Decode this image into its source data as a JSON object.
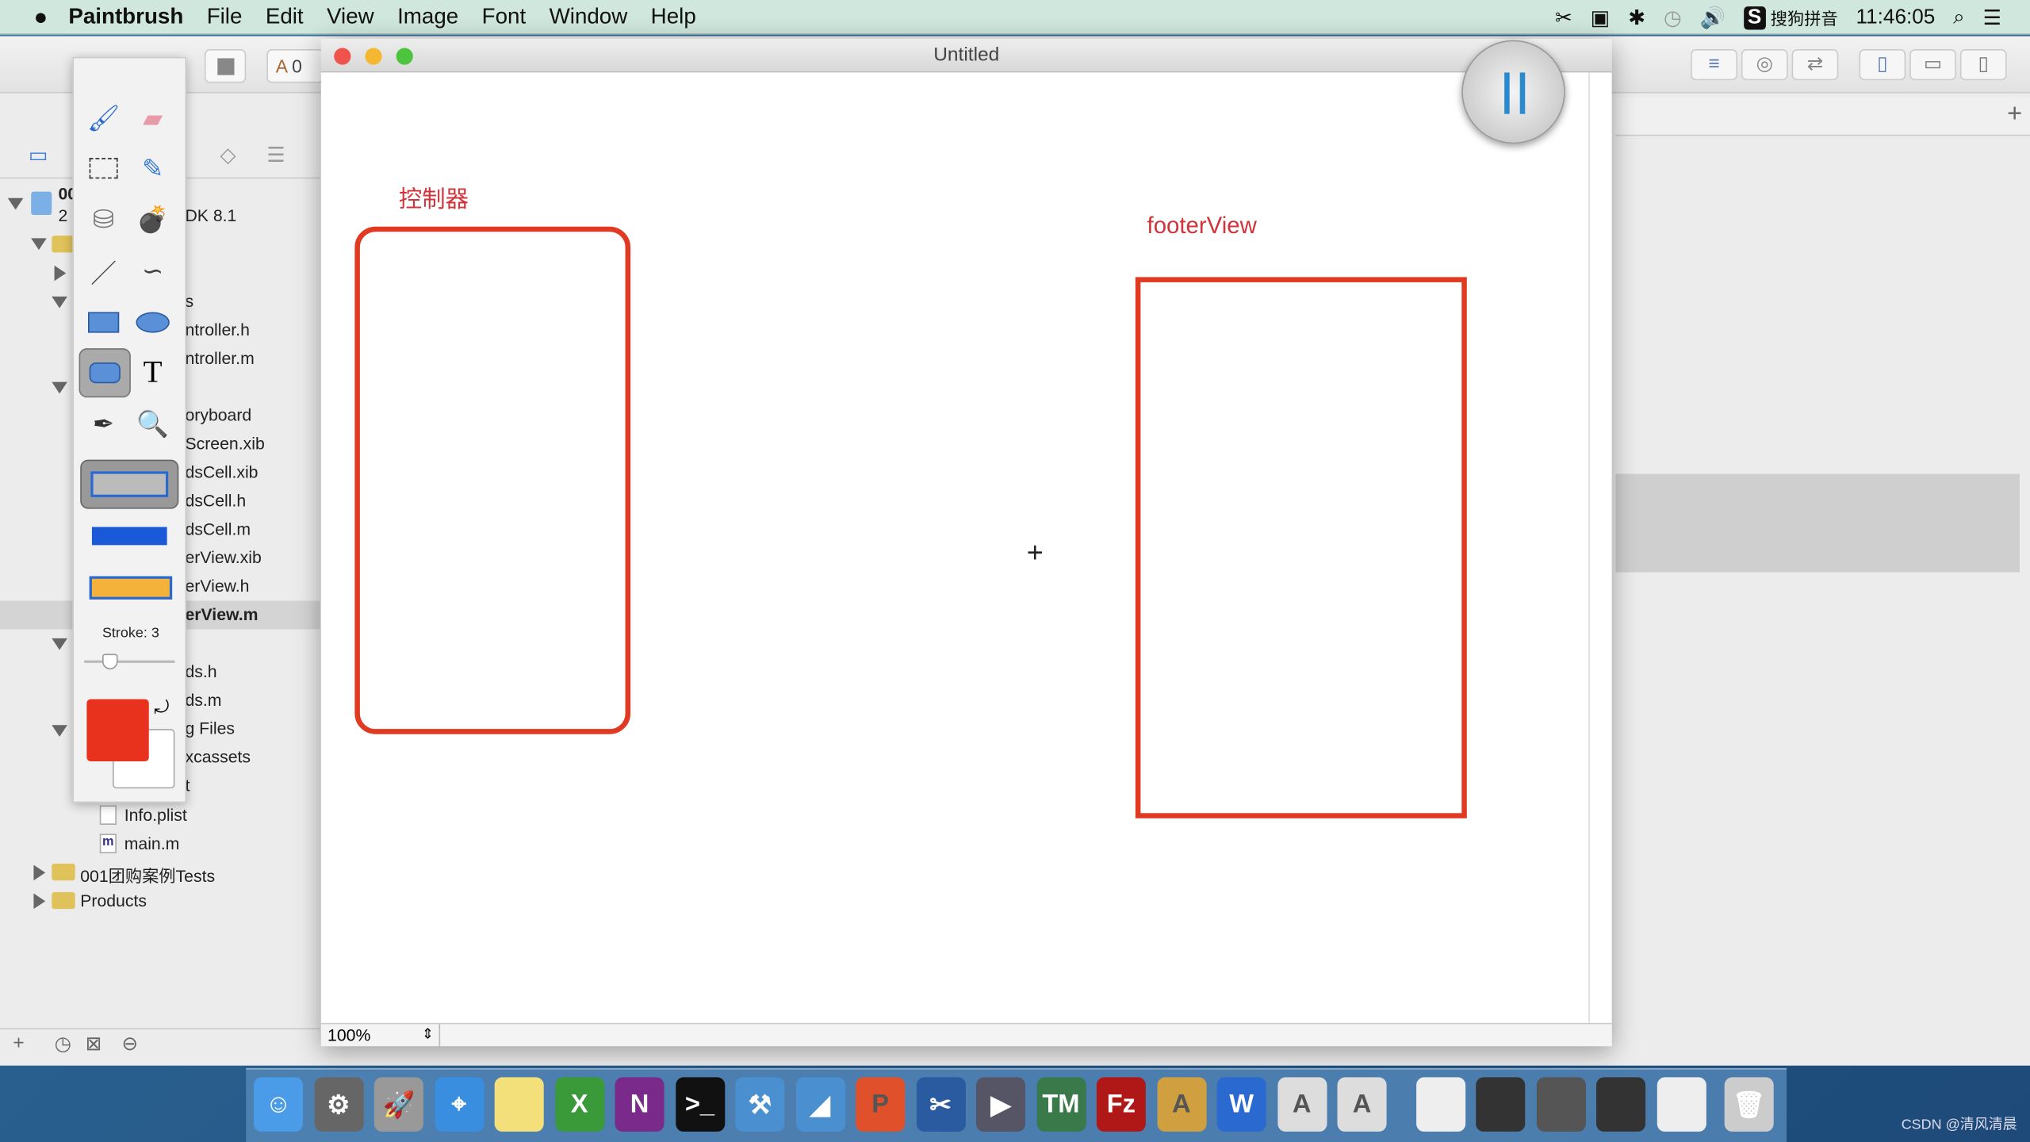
{
  "menubar": {
    "app": "Paintbrush",
    "items": [
      "File",
      "Edit",
      "View",
      "Image",
      "Font",
      "Window",
      "Help"
    ],
    "status": {
      "input_method": "搜狗拼音",
      "time": "11:46:05"
    }
  },
  "xcode": {
    "navigator": {
      "project": "00",
      "project_sub": "2",
      "sdk": "DK 8.1",
      "items": [
        "s",
        "ntroller.h",
        "ntroller.m",
        "oryboard",
        "Screen.xib",
        "dsCell.xib",
        "dsCell.h",
        "dsCell.m",
        "erView.xib",
        "erView.h",
        "erView.m",
        "ds.h",
        "ds.m",
        "g Files",
        "xcassets",
        "t"
      ],
      "info_plist": "Info.plist",
      "main_m": "main.m",
      "tests_group": "001团购案例Tests",
      "products_group": "Products"
    },
    "toolbar_partial": "0"
  },
  "paintbrush": {
    "title": "Untitled",
    "zoom": "100%",
    "stroke_label": "Stroke: 3",
    "stroke": 3,
    "fill_color": "#e8321e",
    "stroke_color": "#ffffff",
    "selected_tool": "rounded-rectangle",
    "canvas": {
      "label_left": "控制器",
      "label_right": "footerView",
      "shape_color": "#e03a22"
    }
  },
  "dock": {
    "apps": [
      {
        "name": "finder",
        "color": "#4a9be8",
        "glyph": "☺"
      },
      {
        "name": "system-preferences",
        "color": "#666",
        "glyph": "⚙"
      },
      {
        "name": "launchpad",
        "color": "#999",
        "glyph": "🚀"
      },
      {
        "name": "safari",
        "color": "#3a8ee0",
        "glyph": "⌖"
      },
      {
        "name": "notes",
        "color": "#f3e07a",
        "glyph": ""
      },
      {
        "name": "excel",
        "color": "#3a9a3a",
        "glyph": "X"
      },
      {
        "name": "onenote",
        "color": "#7a2a8a",
        "glyph": "N"
      },
      {
        "name": "terminal",
        "color": "#111",
        "glyph": ">_"
      },
      {
        "name": "xcode",
        "color": "#4a90d0",
        "glyph": "⚒"
      },
      {
        "name": "preview",
        "color": "#4a90d0",
        "glyph": "◢"
      },
      {
        "name": "powerpoint",
        "color": "#e0502a",
        "glyph": "P"
      },
      {
        "name": "screenshot",
        "color": "#2a5aa0",
        "glyph": "✂"
      },
      {
        "name": "video-app",
        "color": "#556",
        "glyph": "▶"
      },
      {
        "name": "tm-app",
        "color": "#3a7a4a",
        "glyph": "TM"
      },
      {
        "name": "filezilla",
        "color": "#b01818",
        "glyph": "Fz"
      },
      {
        "name": "app-store",
        "color": "#d0a040",
        "glyph": "A"
      },
      {
        "name": "word",
        "color": "#2a6ad0",
        "glyph": "W"
      },
      {
        "name": "textedit-1",
        "color": "#ddd",
        "glyph": "A"
      },
      {
        "name": "textedit-2",
        "color": "#ddd",
        "glyph": "A"
      },
      {
        "name": "minimized-window-1",
        "color": "#eee",
        "glyph": ""
      },
      {
        "name": "minimized-window-2",
        "color": "#333",
        "glyph": ""
      },
      {
        "name": "minimized-window-3",
        "color": "#555",
        "glyph": ""
      },
      {
        "name": "minimized-window-4",
        "color": "#333",
        "glyph": ""
      },
      {
        "name": "minimized-window-5",
        "color": "#eee",
        "glyph": ""
      },
      {
        "name": "trash",
        "color": "#ccc",
        "glyph": "🗑"
      }
    ]
  },
  "watermark": "CSDN @清风清晨"
}
